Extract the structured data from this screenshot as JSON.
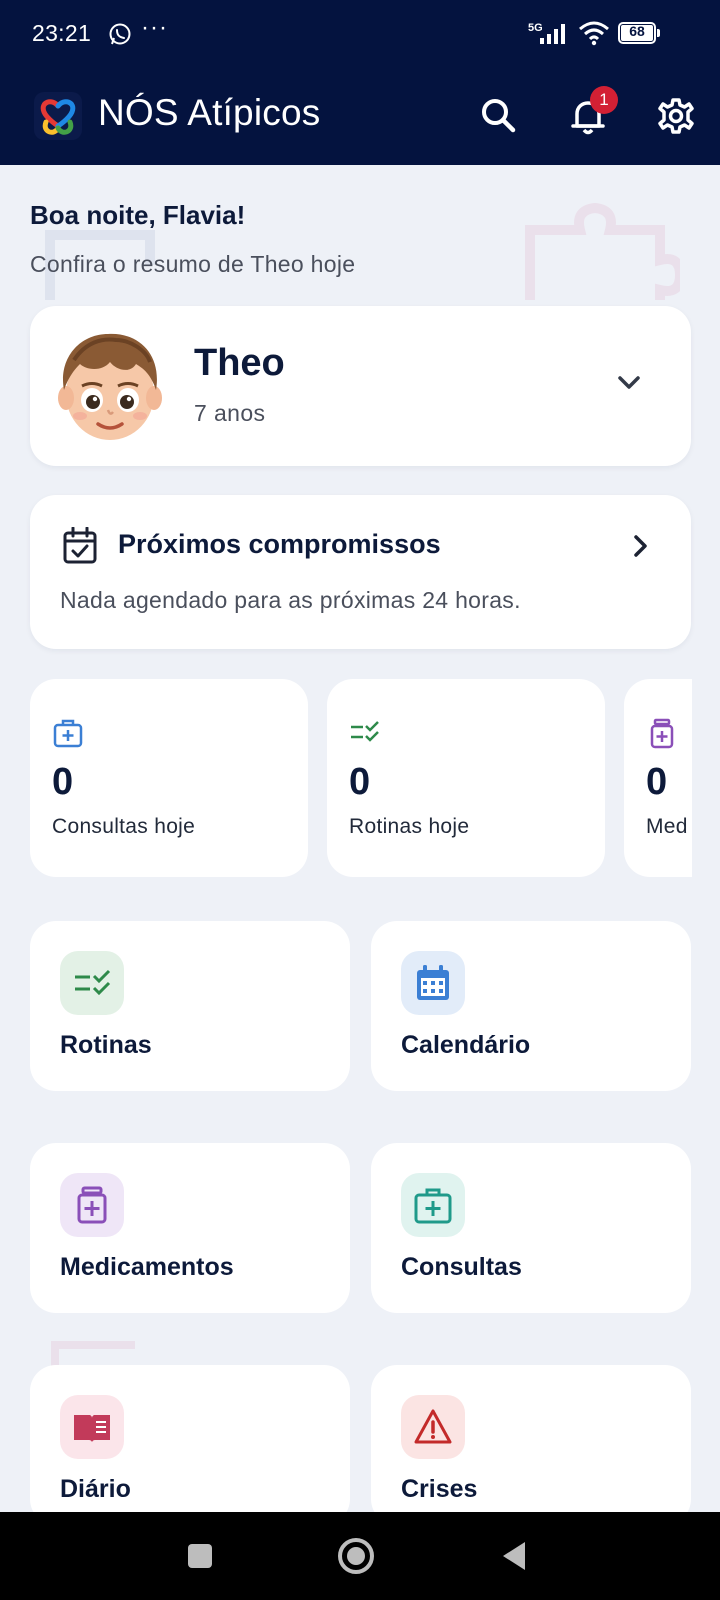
{
  "status_bar": {
    "time": "23:21",
    "more": "···",
    "network": "5G",
    "battery_level": "68"
  },
  "app_bar": {
    "title": "NÓS Atípicos",
    "notification_count": "1"
  },
  "greeting": {
    "title": "Boa noite, Flavia!",
    "subtitle": "Confira o resumo de Theo hoje"
  },
  "child": {
    "name": "Theo",
    "age": "7 anos"
  },
  "appointments": {
    "title": "Próximos compromissos",
    "empty_message": "Nada agendado para as próximas 24 horas."
  },
  "stats": [
    {
      "value": "0",
      "label": "Consultas hoje",
      "icon": "medical-kit-icon",
      "color": "#3b7fd4"
    },
    {
      "value": "0",
      "label": "Rotinas hoje",
      "icon": "checklist-icon",
      "color": "#2e8a4a"
    },
    {
      "value": "0",
      "label": "Med",
      "icon": "medicine-bottle-icon",
      "color": "#8a4fb8"
    }
  ],
  "tiles": [
    {
      "label": "Rotinas",
      "icon": "checklist-icon",
      "color": "#2e8a4a",
      "bg": "#e3f1e6"
    },
    {
      "label": "Calendário",
      "icon": "calendar-icon",
      "color": "#3b7fd4",
      "bg": "#e2ecf9"
    },
    {
      "label": "Medicamentos",
      "icon": "medicine-bottle-icon",
      "color": "#8a4fb8",
      "bg": "#efe6f7"
    },
    {
      "label": "Consultas",
      "icon": "medical-kit-icon",
      "color": "#1f9a8a",
      "bg": "#e0f3ef"
    },
    {
      "label": "Diário",
      "icon": "book-icon",
      "color": "#c23a5a",
      "bg": "#fbe5ea"
    },
    {
      "label": "Crises",
      "icon": "warning-icon",
      "color": "#c32a2a",
      "bg": "#fbe4e3"
    }
  ],
  "colors": {
    "header": "#04133f",
    "background": "#eef1f7",
    "badge": "#d32034"
  }
}
